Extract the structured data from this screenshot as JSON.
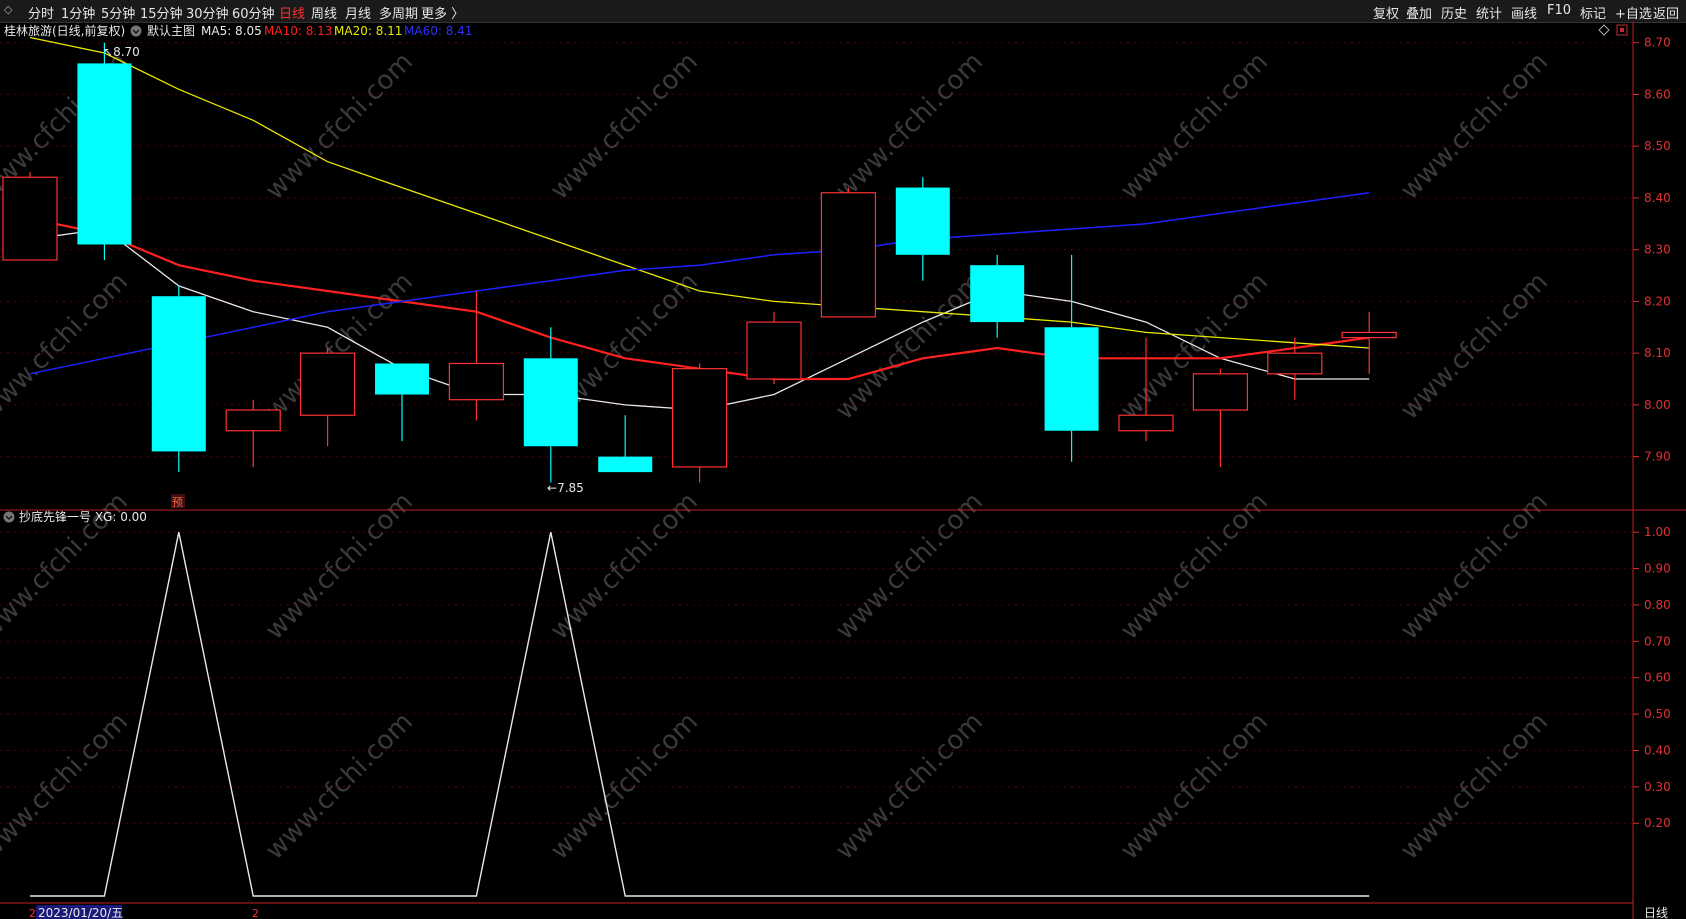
{
  "toolbar": {
    "left_items": [
      "分时",
      "1分钟",
      "5分钟",
      "15分钟",
      "30分钟",
      "60分钟",
      "日线",
      "周线",
      "月线",
      "多周期",
      "更多 〉"
    ],
    "active": "日线",
    "right_items": [
      "复权",
      "叠加",
      "历史",
      "统计",
      "画线",
      "F10",
      "标记",
      "+自选",
      "返回"
    ]
  },
  "main_panel": {
    "title": "桂林旅游(日线,前复权)",
    "indicator_name": "默认主图",
    "ma_items": [
      {
        "label": "MA5: 8.05",
        "color": "#e8e8e8"
      },
      {
        "label": "MA10: 8.13",
        "color": "#ff2020"
      },
      {
        "label": "MA20: 8.11",
        "color": "#e8e800"
      },
      {
        "label": "MA60: 8.41",
        "color": "#3030ff"
      }
    ],
    "high_marker": "8.70",
    "low_marker": "7.85",
    "pre_mark": "预"
  },
  "sub_panel": {
    "title": "抄底先锋一号 XG: 0.00"
  },
  "watermark": "www.cfchi.com",
  "date_label": "2023/01/20/五",
  "bottom_marks": [
    "2",
    "2"
  ],
  "period_label": "日线",
  "colors": {
    "up": "#ff3030",
    "down": "#00ffff",
    "ma5": "#e8e8e8",
    "ma10": "#ff2020",
    "ma20": "#e8e800",
    "ma60": "#2020ff",
    "grid": "#5a0000",
    "axis": "#e03030"
  },
  "chart_data": [
    {
      "type": "candlestick",
      "title": "桂林旅游(日线,前复权)",
      "ylim": [
        7.82,
        8.74
      ],
      "price_ticks": [
        8.7,
        8.6,
        8.5,
        8.4,
        8.3,
        8.2,
        8.1,
        8.0,
        7.9
      ],
      "candles": [
        {
          "o": 8.28,
          "c": 8.44,
          "h": 8.45,
          "l": 8.28
        },
        {
          "o": 8.66,
          "c": 8.31,
          "h": 8.7,
          "l": 8.28
        },
        {
          "o": 8.21,
          "c": 7.91,
          "h": 8.23,
          "l": 7.87
        },
        {
          "o": 7.95,
          "c": 7.99,
          "h": 8.01,
          "l": 7.88
        },
        {
          "o": 7.98,
          "c": 8.1,
          "h": 8.11,
          "l": 7.92
        },
        {
          "o": 8.08,
          "c": 8.02,
          "h": 8.08,
          "l": 7.93
        },
        {
          "o": 8.01,
          "c": 8.08,
          "h": 8.22,
          "l": 7.97
        },
        {
          "o": 8.09,
          "c": 7.92,
          "h": 8.15,
          "l": 7.85
        },
        {
          "o": 7.9,
          "c": 7.87,
          "h": 7.98,
          "l": 7.87
        },
        {
          "o": 7.88,
          "c": 8.07,
          "h": 8.08,
          "l": 7.85
        },
        {
          "o": 8.05,
          "c": 8.16,
          "h": 8.18,
          "l": 8.04
        },
        {
          "o": 8.17,
          "c": 8.41,
          "h": 8.42,
          "l": 8.17
        },
        {
          "o": 8.42,
          "c": 8.29,
          "h": 8.44,
          "l": 8.24
        },
        {
          "o": 8.27,
          "c": 8.16,
          "h": 8.29,
          "l": 8.13
        },
        {
          "o": 8.15,
          "c": 7.95,
          "h": 8.29,
          "l": 7.89
        },
        {
          "o": 7.95,
          "c": 7.98,
          "h": 8.13,
          "l": 7.93
        },
        {
          "o": 7.99,
          "c": 8.06,
          "h": 8.07,
          "l": 7.88
        },
        {
          "o": 8.06,
          "c": 8.1,
          "h": 8.13,
          "l": 8.01
        },
        {
          "o": 8.13,
          "c": 8.14,
          "h": 8.18,
          "l": 8.06
        }
      ],
      "series": [
        {
          "name": "MA5",
          "values": [
            8.32,
            8.34,
            8.23,
            8.18,
            8.15,
            8.07,
            8.02,
            8.02,
            8.0,
            7.99,
            8.02,
            8.09,
            8.16,
            8.22,
            8.2,
            8.16,
            8.09,
            8.05,
            8.05
          ]
        },
        {
          "name": "MA10",
          "values": [
            8.36,
            8.33,
            8.27,
            8.24,
            8.22,
            8.2,
            8.18,
            8.13,
            8.09,
            8.07,
            8.05,
            8.05,
            8.09,
            8.11,
            8.09,
            8.09,
            8.09,
            8.11,
            8.13
          ]
        },
        {
          "name": "MA20",
          "values": [
            8.71,
            8.68,
            8.61,
            8.55,
            8.47,
            8.42,
            8.37,
            8.32,
            8.27,
            8.22,
            8.2,
            8.19,
            8.18,
            8.17,
            8.16,
            8.14,
            8.13,
            8.12,
            8.11
          ]
        },
        {
          "name": "MA60",
          "values": [
            8.06,
            8.09,
            8.12,
            8.15,
            8.18,
            8.2,
            8.22,
            8.24,
            8.26,
            8.27,
            8.29,
            8.3,
            8.32,
            8.33,
            8.34,
            8.35,
            8.37,
            8.39,
            8.41
          ]
        }
      ]
    },
    {
      "type": "line",
      "title": "抄底先锋一号 XG: 0.00",
      "ylim": [
        0,
        1.05
      ],
      "ticks": [
        1.0,
        0.9,
        0.8,
        0.7,
        0.6,
        0.5,
        0.4,
        0.3,
        0.2
      ],
      "x": [
        0,
        1,
        2,
        3,
        4,
        5,
        6,
        7,
        8,
        9,
        10,
        11,
        12,
        13,
        14,
        15,
        16,
        17,
        18
      ],
      "series": [
        {
          "name": "XG",
          "values": [
            0,
            0,
            1,
            0,
            0,
            0,
            0,
            1,
            0,
            0,
            0,
            0,
            0,
            0,
            0,
            0,
            0,
            0,
            0
          ]
        }
      ]
    }
  ]
}
